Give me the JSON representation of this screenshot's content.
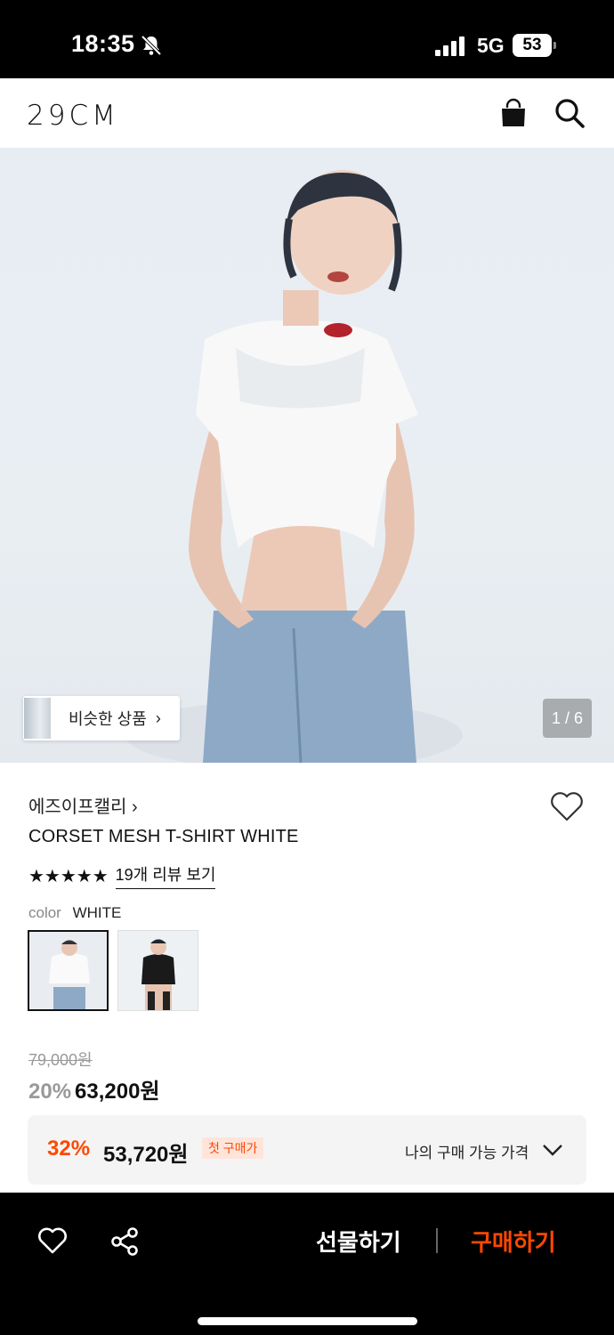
{
  "status_bar": {
    "time": "18:35",
    "network": "5G",
    "battery": "53"
  },
  "header": {
    "logo": "29CM"
  },
  "hero": {
    "similar_label": "비슷한 상품",
    "page_indicator": "1 / 6"
  },
  "product": {
    "brand": "에즈이프캘리 ›",
    "title": "CORSET MESH T-SHIRT WHITE",
    "stars": "★★★★★",
    "rating_value": 5,
    "review_link": "19개 리뷰 보기",
    "color_key": "color",
    "color_value": "WHITE",
    "original_price": "79,000원",
    "discount": "20%",
    "sale_price": "63,200원"
  },
  "first_purchase": {
    "discount": "32%",
    "price": "53,720원",
    "badge": "첫 구매가",
    "my_price_label": "나의 구매 가능 가격"
  },
  "bottom_bar": {
    "gift_label": "선물하기",
    "buy_label": "구매하기"
  },
  "colors": {
    "accent": "#ff4800",
    "dark": "#000000"
  }
}
